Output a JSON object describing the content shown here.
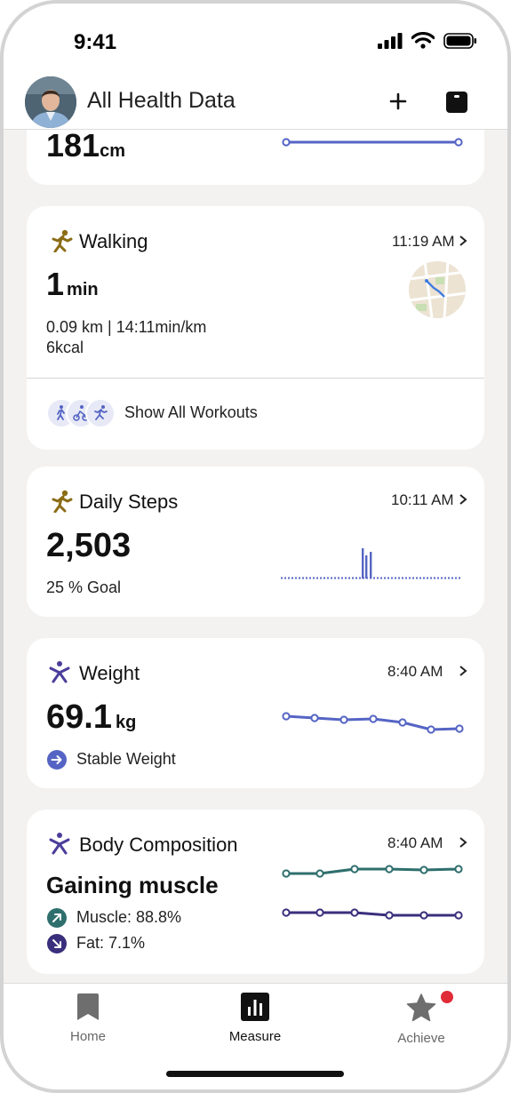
{
  "status_bar": {
    "time": "9:41"
  },
  "header": {
    "title": "All Health Data"
  },
  "height_card": {
    "value": "181",
    "unit": "cm"
  },
  "walking_card": {
    "title": "Walking",
    "time": "11:19 AM",
    "duration_value": "1",
    "duration_unit": "min",
    "detail_line1": "0.09 km | 14:11min/km",
    "detail_line2": "6kcal",
    "show_all_label": "Show All Workouts"
  },
  "steps_card": {
    "title": "Daily Steps",
    "time": "10:11 AM",
    "value": "2,503",
    "goal": "25 % Goal"
  },
  "weight_card": {
    "title": "Weight",
    "time": "8:40 AM",
    "value": "69.1",
    "unit": "kg",
    "trend": "Stable Weight"
  },
  "body_card": {
    "title": "Body Composition",
    "time": "8:40 AM",
    "status": "Gaining muscle",
    "muscle": "Muscle: 88.8%",
    "fat": "Fat: 7.1%"
  },
  "tabbar": {
    "items": [
      {
        "label": "Home",
        "icon": "bookmark-icon",
        "active": false
      },
      {
        "label": "Measure",
        "icon": "bar-chart-icon",
        "active": true
      },
      {
        "label": "Achieve",
        "icon": "star-icon",
        "active": false,
        "badge": true
      }
    ]
  },
  "colors": {
    "accent_blue": "#5564c4",
    "walking_gold": "#8b6d16",
    "weight_purple": "#4a3d9a",
    "muscle_teal": "#2e6f6d",
    "fat_purple": "#3a2f7c",
    "badge_red": "#e02b38"
  }
}
